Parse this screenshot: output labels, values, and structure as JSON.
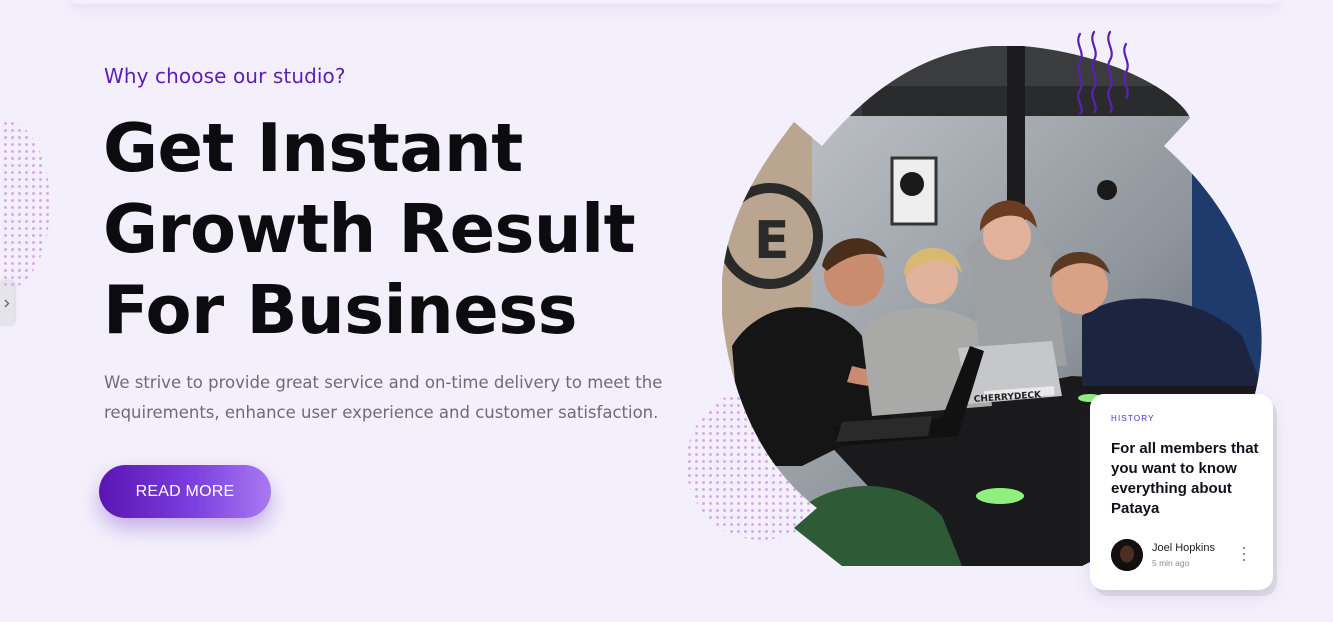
{
  "hero": {
    "eyebrow": "Why choose our studio?",
    "headline_lines": [
      "Get Instant",
      "Growth Result",
      "For Business"
    ],
    "intro": "We strive to provide great service and on-time delivery to meet the requirements, enhance user experience and customer satisfaction.",
    "cta_label": "READ MORE"
  },
  "side_tab": {
    "icon": "chevron-right-icon"
  },
  "photo": {
    "icon": "team-photo",
    "laptop_sticker": "CHERRYDECK"
  },
  "card": {
    "tag": "HISTORY",
    "title": "For all members that you want to know everything about Pataya",
    "author": {
      "name": "Joel Hopkins",
      "time": "5 min ago"
    },
    "menu_icon": "more-vertical-icon"
  },
  "colors": {
    "background": "#f3f0fb",
    "accent": "#5b1fb3",
    "button_gradient_start": "#5a14b4",
    "button_gradient_end": "#a87af0",
    "dots": "#d9a8ef",
    "squiggle": "#5b1fb3"
  }
}
